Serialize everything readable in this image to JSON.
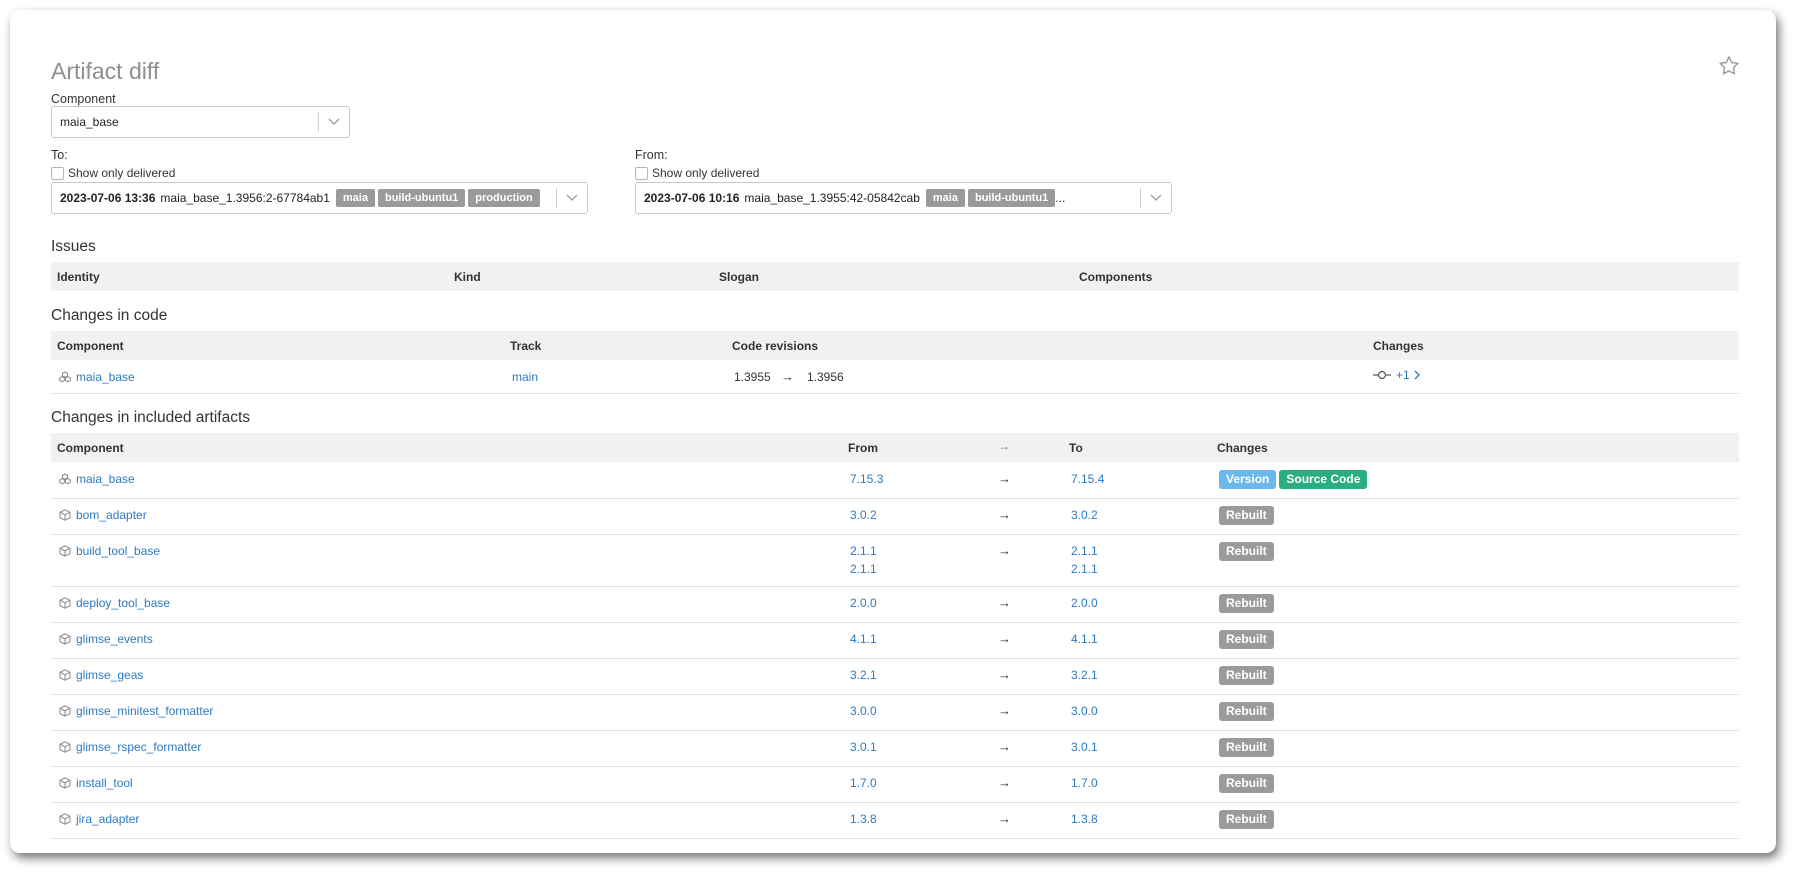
{
  "page": {
    "title": "Artifact diff"
  },
  "component_select": {
    "label": "Component",
    "value": "maia_base"
  },
  "to": {
    "label": "To:",
    "show_only_delivered": "Show only delivered",
    "date": "2023-07-06 13:36",
    "artifact": "maia_base_1.3956:2-67784ab1",
    "tags": [
      "maia",
      "build-ubuntu1",
      "production"
    ]
  },
  "from": {
    "label": "From:",
    "show_only_delivered": "Show only delivered",
    "date": "2023-07-06 10:16",
    "artifact": "maia_base_1.3955:42-05842cab",
    "tags": [
      "maia",
      "build-ubuntu1"
    ],
    "ellipsis": "..."
  },
  "issues": {
    "title": "Issues",
    "headers": {
      "identity": "Identity",
      "kind": "Kind",
      "slogan": "Slogan",
      "components": "Components"
    }
  },
  "code_changes": {
    "title": "Changes in code",
    "headers": {
      "component": "Component",
      "track": "Track",
      "code_revisions": "Code revisions",
      "changes": "Changes"
    },
    "rows": [
      {
        "component": "maia_base",
        "track": "main",
        "from": "1.3955",
        "to": "1.3956",
        "changes": "+1"
      }
    ]
  },
  "artifact_changes": {
    "title": "Changes in included artifacts",
    "headers": {
      "component": "Component",
      "from": "From",
      "to": "To",
      "changes": "Changes"
    },
    "rows": [
      {
        "component": "maia_base",
        "from": "7.15.3",
        "to": "7.15.4",
        "badges": [
          "Version",
          "Source Code"
        ]
      },
      {
        "component": "bom_adapter",
        "from": "3.0.2",
        "to": "3.0.2",
        "badges": [
          "Rebuilt"
        ]
      },
      {
        "component": "build_tool_base",
        "from": "2.1.1",
        "from2": "2.1.1",
        "to": "2.1.1",
        "to2": "2.1.1",
        "badges": [
          "Rebuilt"
        ]
      },
      {
        "component": "deploy_tool_base",
        "from": "2.0.0",
        "to": "2.0.0",
        "badges": [
          "Rebuilt"
        ]
      },
      {
        "component": "glimse_events",
        "from": "4.1.1",
        "to": "4.1.1",
        "badges": [
          "Rebuilt"
        ]
      },
      {
        "component": "glimse_geas",
        "from": "3.2.1",
        "to": "3.2.1",
        "badges": [
          "Rebuilt"
        ]
      },
      {
        "component": "glimse_minitest_formatter",
        "from": "3.0.0",
        "to": "3.0.0",
        "badges": [
          "Rebuilt"
        ]
      },
      {
        "component": "glimse_rspec_formatter",
        "from": "3.0.1",
        "to": "3.0.1",
        "badges": [
          "Rebuilt"
        ]
      },
      {
        "component": "install_tool",
        "from": "1.7.0",
        "to": "1.7.0",
        "badges": [
          "Rebuilt"
        ]
      },
      {
        "component": "jira_adapter",
        "from": "1.3.8",
        "to": "1.3.8",
        "badges": [
          "Rebuilt"
        ]
      }
    ]
  },
  "colors": {
    "link": "#2c7bc2",
    "version_badge": "#6ab7ea",
    "source_badge": "#2aae7f",
    "rebuilt_badge": "#9a9a9a",
    "tag": "#9a9a9a"
  },
  "icons": {
    "favorite": "star-icon",
    "dropdown": "chevron-down-icon",
    "component_group": "components-icon",
    "package": "package-icon",
    "commit": "commit-icon",
    "arrow": "arrow-right-icon"
  }
}
